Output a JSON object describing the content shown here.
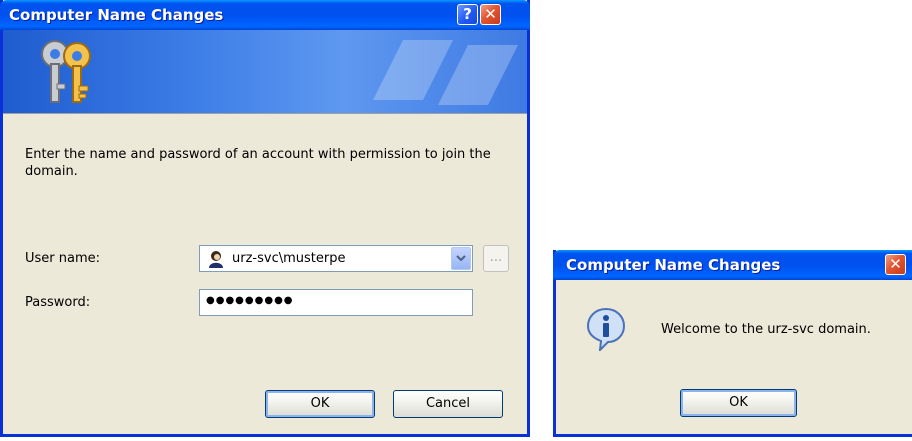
{
  "login_dialog": {
    "title": "Computer Name Changes",
    "help_glyph": "?",
    "close_glyph": "✕",
    "banner_icon": "keys-icon",
    "prompt": "Enter the name and password of an account with permission to join the domain.",
    "username_label": "User name:",
    "username_value": "urz-svc\\musterpe",
    "user_icon": "user-icon",
    "password_label": "Password:",
    "password_value": "●●●●●●●●●",
    "browse_label": "...",
    "ok_label": "OK",
    "cancel_label": "Cancel"
  },
  "welcome_dialog": {
    "title": "Computer Name Changes",
    "close_glyph": "✕",
    "icon": "info-icon",
    "message": "Welcome to the urz-svc domain.",
    "ok_label": "OK"
  },
  "colors": {
    "titlebar": "#0053ee",
    "dialog_bg": "#ece9d8",
    "frame": "#0831d9",
    "close": "#e15630"
  }
}
